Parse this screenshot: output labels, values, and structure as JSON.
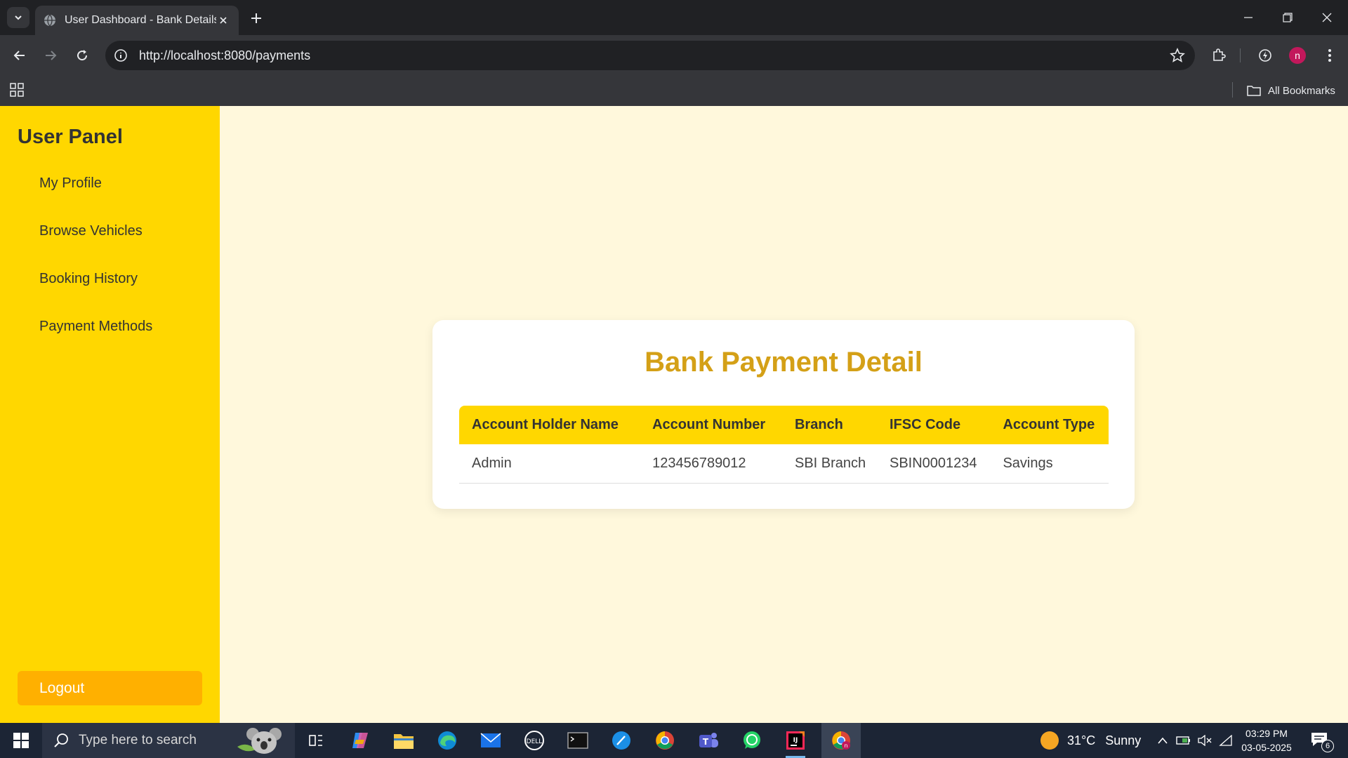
{
  "browser": {
    "tab_title": "User Dashboard - Bank Details",
    "url": "http://localhost:8080/payments",
    "all_bookmarks": "All Bookmarks",
    "profile_initial": "n"
  },
  "sidebar": {
    "title": "User Panel",
    "items": [
      {
        "label": "My Profile"
      },
      {
        "label": "Browse Vehicles"
      },
      {
        "label": "Booking History"
      },
      {
        "label": "Payment Methods"
      }
    ],
    "logout_label": "Logout"
  },
  "main": {
    "title": "Bank Payment Detail",
    "columns": [
      "Account Holder Name",
      "Account Number",
      "Branch",
      "IFSC Code",
      "Account Type"
    ],
    "rows": [
      [
        "Admin",
        "123456789012",
        "SBI Branch",
        "SBIN0001234",
        "Savings"
      ]
    ]
  },
  "taskbar": {
    "search_placeholder": "Type here to search",
    "weather_temp": "31°C",
    "weather_condition": "Sunny",
    "time": "03:29 PM",
    "date": "03-05-2025",
    "notification_count": "6"
  },
  "colors": {
    "sidebar_bg": "#ffd700",
    "page_bg": "#fff8dc",
    "title_color": "#d4a017",
    "logout_bg": "#ffb000"
  }
}
